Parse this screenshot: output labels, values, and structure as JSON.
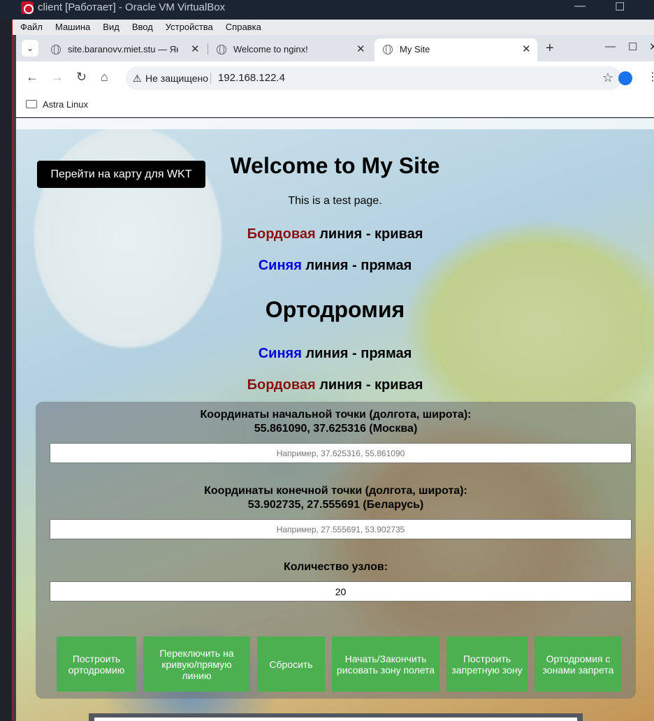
{
  "vbox": {
    "title": "client [Работает] - Oracle VM VirtualBox",
    "minimize": "—",
    "maximize": "☐",
    "menu": [
      "Файл",
      "Машина",
      "Вид",
      "Ввод",
      "Устройства",
      "Справка"
    ]
  },
  "browser": {
    "tab_dropdown": "⌄",
    "tabs": [
      {
        "label": "site.baranovv.miet.stu — Ян",
        "close": "✕"
      },
      {
        "label": "Welcome to nginx!",
        "close": "✕"
      },
      {
        "label": "My Site",
        "close": "✕"
      }
    ],
    "new_tab": "+",
    "window_controls": {
      "minimize": "—",
      "maximize": "☐",
      "close": "✕"
    },
    "nav": {
      "back": "←",
      "forward": "→",
      "reload": "↻",
      "home": "⌂"
    },
    "omnibox": {
      "warning_icon": "⚠",
      "security_label": "Не защищено",
      "url": "192.168.122.4",
      "star": "☆"
    },
    "menu_icon": "⋮",
    "bookmarks": [
      {
        "label": "Astra Linux"
      }
    ]
  },
  "page": {
    "wkt_button": "Перейти на карту для WKT",
    "title": "Welcome to My Site",
    "subtitle": "This is a test page.",
    "legend_top": [
      {
        "colored": "Бордовая",
        "rest": " линия - кривая",
        "color": "#8b1010"
      },
      {
        "colored": "Синяя",
        "rest": " линия - прямая",
        "color": "#0000e0"
      }
    ],
    "section_title": "Ортодромия",
    "legend_bottom": [
      {
        "colored": "Синяя",
        "rest": " линия - прямая",
        "color": "#0000e0"
      },
      {
        "colored": "Бордовая",
        "rest": " линия - кривая",
        "color": "#8b1010"
      }
    ],
    "form": {
      "start_label": "Координаты начальной точки (долгота, широта):",
      "start_value": "55.861090, 37.625316 (Москва)",
      "start_placeholder": "Например, 37.625316, 55.861090",
      "end_label": "Координаты конечной точки (долгота, широта):",
      "end_value": "53.902735, 27.555691 (Беларусь)",
      "end_placeholder": "Например, 27.555691, 53.902735",
      "nodes_label": "Количество узлов:",
      "nodes_value": "20"
    },
    "buttons": [
      "Построить ортодромию",
      "Переключить на кривую/прямую линию",
      "Сбросить",
      "Начать/Закончить рисовать зону полета",
      "Построить запретную зону",
      "Ортодромия с зонами запрета"
    ],
    "accent_color": "#4caf50"
  }
}
